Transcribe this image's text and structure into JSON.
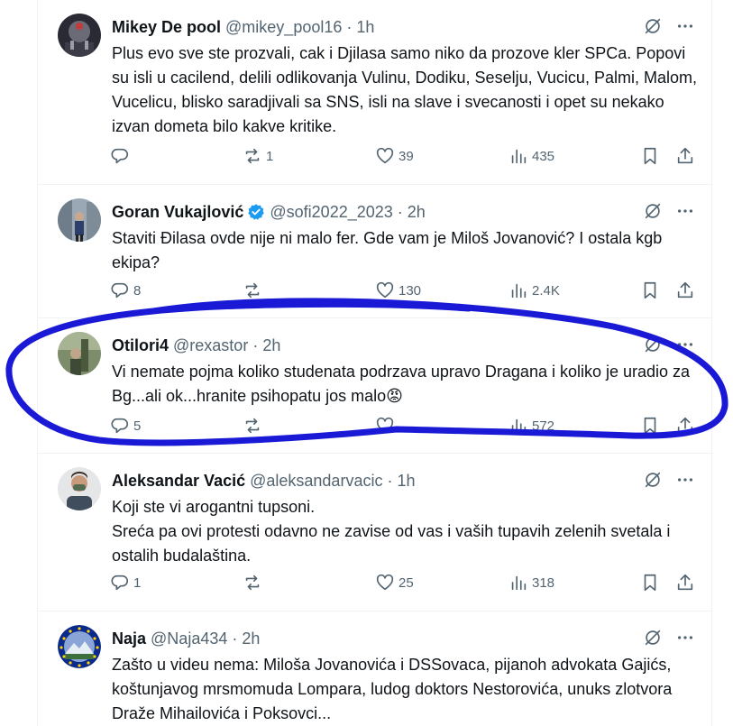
{
  "tweets": [
    {
      "name": "Mikey De pool",
      "handle": "@mikey_pool16",
      "time": "1h",
      "text": "Plus evo sve ste prozvali, cak i Djilasa samo niko da prozove kler SPCa. Popovi su isli u cacilend, delili odlikovanja Vulinu, Dodiku, Seselju, Vucicu, Palmi, Malom, Vucelicu, blisko saradjivali sa SNS, isli na slave i svecanosti i opet su nekako izvan dometa bilo kakve kritike.",
      "replies": "",
      "reposts": "1",
      "likes": "39",
      "views": "435",
      "verified": false
    },
    {
      "name": "Goran Vukajlović",
      "handle": "@sofi2022_2023",
      "time": "2h",
      "text": "Staviti Đilasa ovde nije ni malo fer. Gde vam je Miloš Jovanović? I ostala kgb ekipa?",
      "replies": "8",
      "reposts": "",
      "likes": "130",
      "views": "2.4K",
      "verified": true
    },
    {
      "name": "Otilori4",
      "handle": "@rexastor",
      "time": "2h",
      "text": "Vi nemate pojma koliko studenata podrzava upravo Dragana i koliko je uradio za Bg...ali ok...hranite psihopatu jos malo😡",
      "replies": "5",
      "reposts": "",
      "likes": "",
      "views": "572",
      "verified": false
    },
    {
      "name": "Aleksandar Vacić",
      "handle": "@aleksandarvacic",
      "time": "1h",
      "text": "Koji ste vi arogantni tupsoni.\nSreća pa ovi protesti odavno ne zavise od vas i vaših tupavih zelenih svetala i ostalih budalaština.",
      "replies": "1",
      "reposts": "",
      "likes": "25",
      "views": "318",
      "verified": false
    },
    {
      "name": "Naja",
      "handle": "@Naja434",
      "time": "2h",
      "text": "Zašto u videu nema: Miloša Jovanovića i DSSovaca, pijanoh advokata Gajićs, koštunjavog mrsmomuda Lompara, ludog doktors Nestorovića, unuks zlotvora Draže Mihailovića i Poksovci...",
      "verified": false
    }
  ],
  "icons": {
    "grok": "grok-icon",
    "more": "more-icon",
    "reply": "reply-icon",
    "repost": "repost-icon",
    "like": "like-icon",
    "views": "views-icon",
    "bookmark": "bookmark-icon",
    "share": "share-icon"
  },
  "colors": {
    "text": "#0f1419",
    "secondary": "#536471",
    "verified": "#1d9bf0",
    "annotation": "#1a1ad6"
  }
}
